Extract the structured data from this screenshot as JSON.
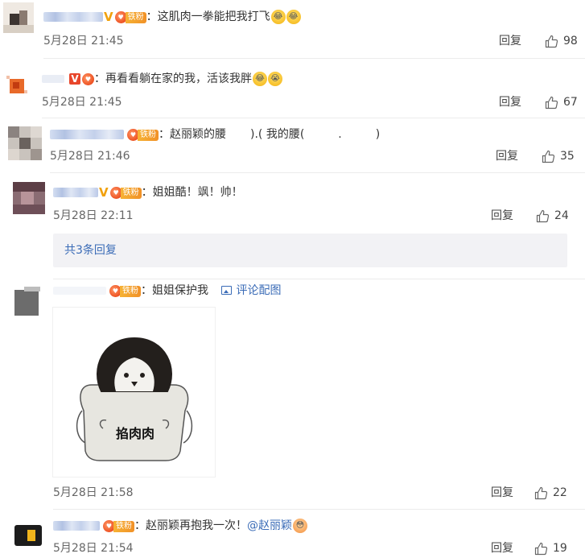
{
  "comments": [
    {
      "text": "这肌肉一拳能把我打飞",
      "time": "5月28日 21:45",
      "reply_label": "回复",
      "likes": "98",
      "badges": {
        "v": "V",
        "fan_tag": "铁粉"
      }
    },
    {
      "text": "再看看躺在家的我，活该我胖",
      "time": "5月28日 21:45",
      "reply_label": "回复",
      "likes": "67",
      "badges": {
        "v": "V"
      }
    },
    {
      "text_a": "赵丽颖的腰",
      "text_b": ").( 我的腰(",
      "text_c": ".",
      "text_d": ")",
      "time": "5月28日 21:46",
      "reply_label": "回复",
      "likes": "35",
      "badges": {
        "fan_tag": "铁粉"
      }
    },
    {
      "text": "姐姐酷！飒！帅！",
      "time": "5月28日 22:11",
      "reply_label": "回复",
      "likes": "24",
      "badges": {
        "v": "V",
        "fan_tag": "铁粉"
      },
      "more_replies": "共3条回复"
    },
    {
      "text": "姐姐保护我",
      "pic_link": "评论配图",
      "image_caption": "掐肉肉",
      "time": "5月28日 21:58",
      "reply_label": "回复",
      "likes": "22",
      "badges": {
        "fan_tag": "铁粉"
      }
    },
    {
      "text": "赵丽颖再抱我一次！",
      "mention": "@赵丽颖",
      "time": "5月28日 21:54",
      "reply_label": "回复",
      "likes": "19",
      "badges": {
        "fan_tag": "铁粉"
      }
    }
  ],
  "colon": "：",
  "colors": {
    "link": "#3b6cb7",
    "text": "#333333",
    "meta": "#666666",
    "divider": "#ececec",
    "box": "#f2f2f5"
  },
  "icons": {
    "like": "thumbs-up-icon",
    "pic": "image-icon",
    "emoji": "laughing-crying-emoji-icon"
  }
}
